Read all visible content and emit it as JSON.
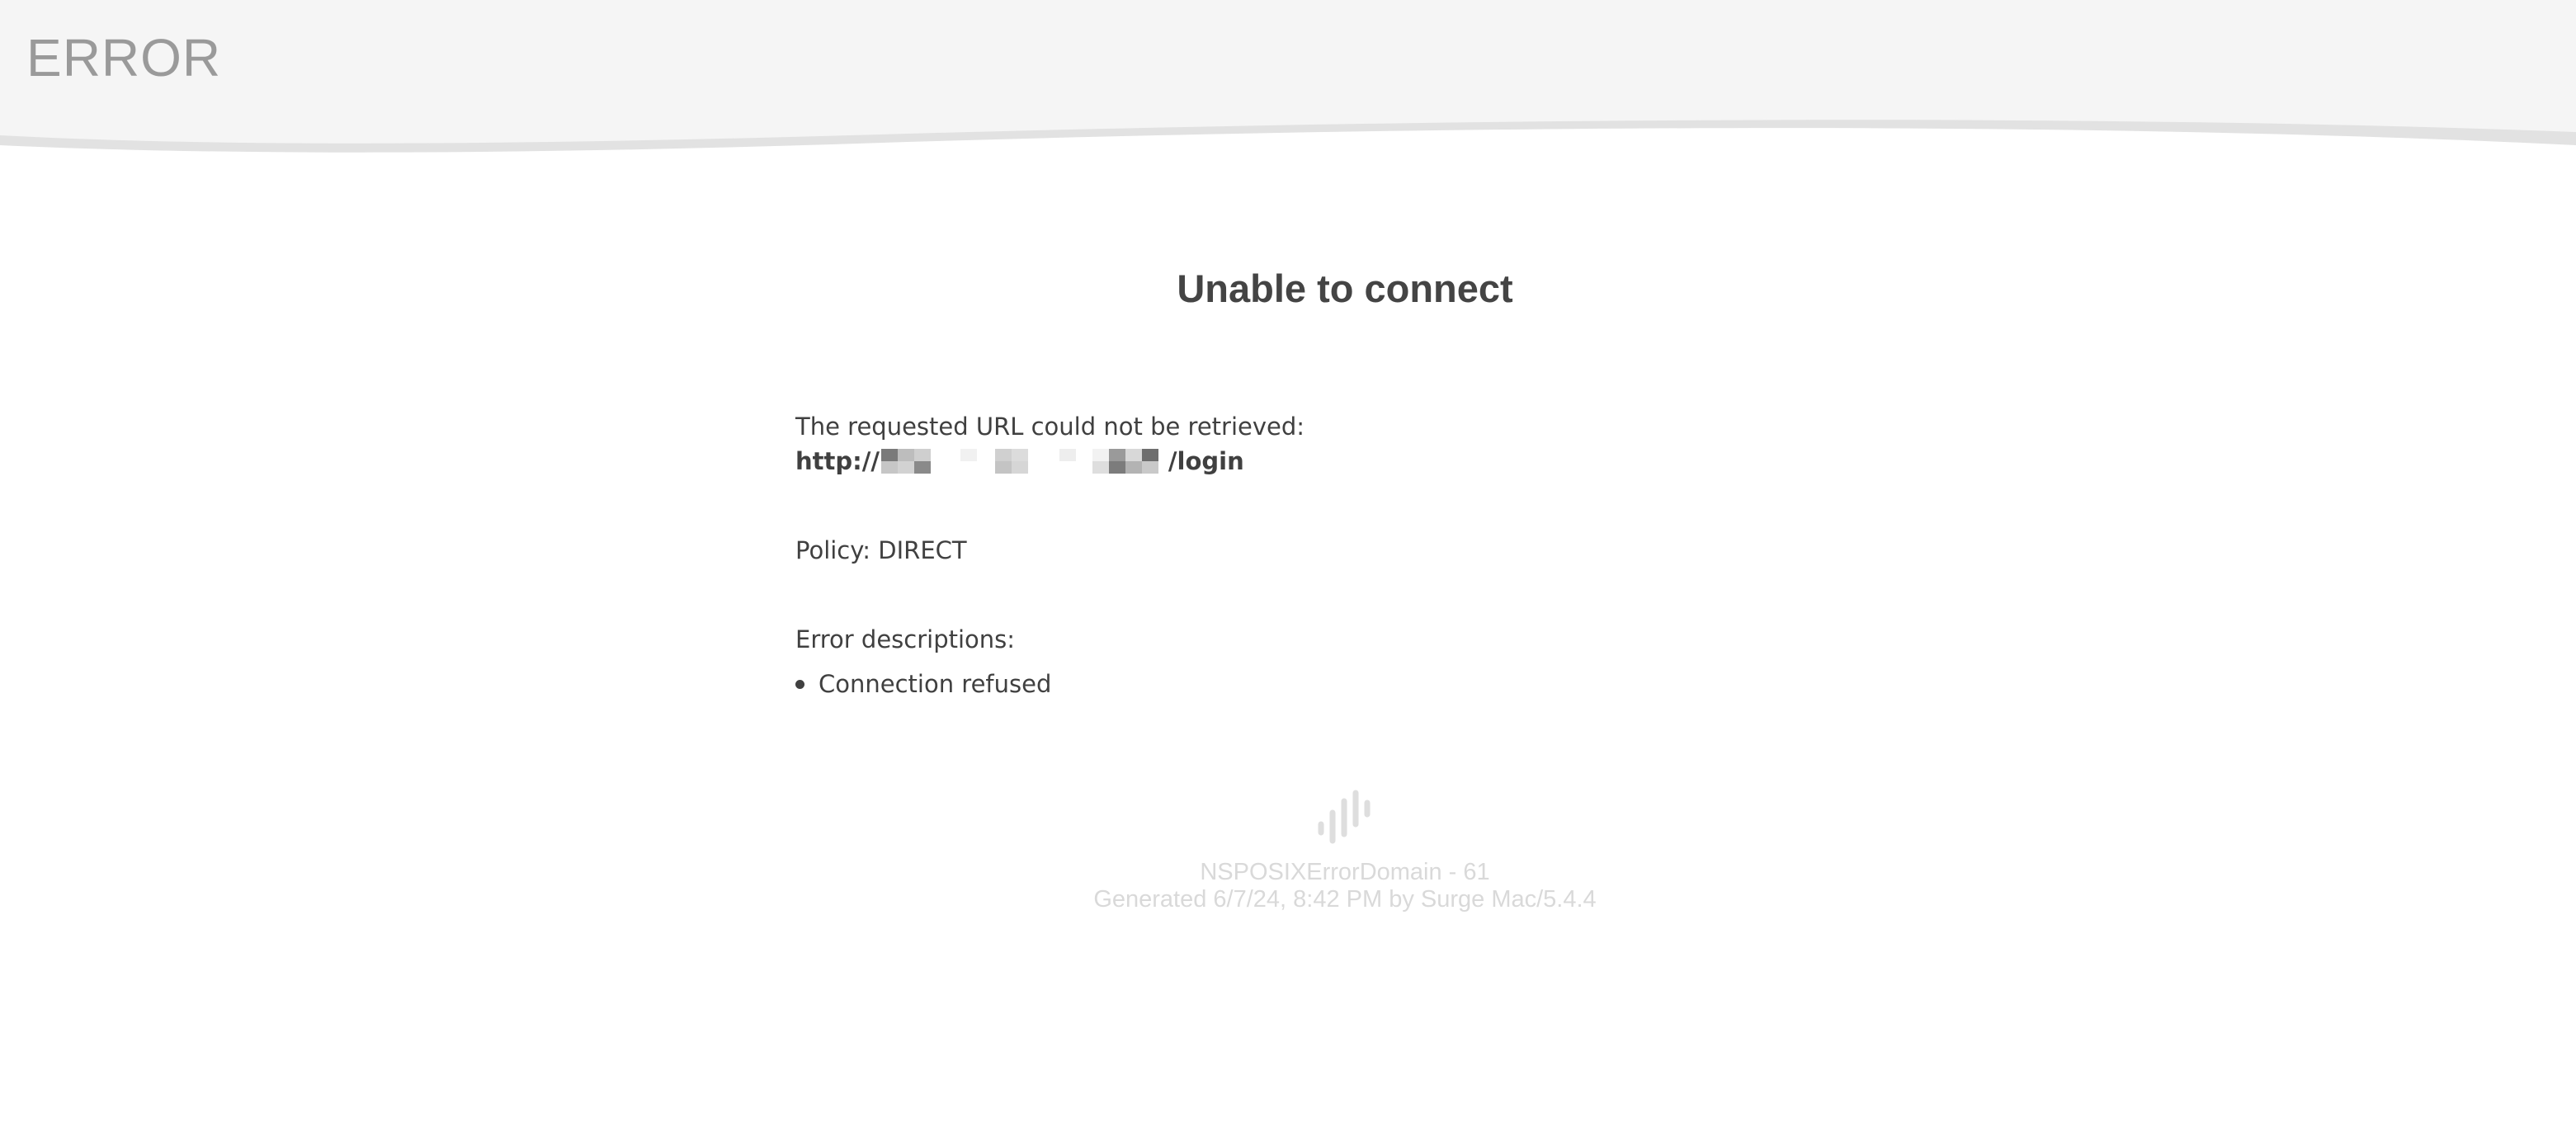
{
  "header": {
    "title": "ERROR"
  },
  "main": {
    "title": "Unable to connect",
    "url_label": "The requested URL could not be retrieved:",
    "url_prefix": "http://",
    "url_suffix": "/login",
    "policy": "Policy: DIRECT",
    "error_label": "Error descriptions:",
    "errors": [
      "Connection refused"
    ]
  },
  "footer": {
    "icon": "surge-logo-icon",
    "error_domain": "NSPOSIXErrorDomain - 61",
    "generated": "Generated 6/7/24, 8:42 PM by Surge Mac/5.4.4"
  },
  "colors": {
    "header_bg": "#f5f5f5",
    "wave_shadow": "#e2e2e2",
    "text": "#404040",
    "muted": "#9a9a9a",
    "footer_text": "#d9d9d9"
  }
}
